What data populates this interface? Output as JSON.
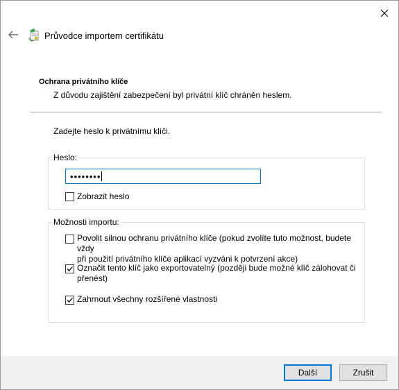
{
  "window": {
    "title": "Průvodce importem certifikátu"
  },
  "icons": {
    "close": "close-icon",
    "back": "back-arrow-icon",
    "wizard": "certificate-wizard-icon"
  },
  "header": {
    "heading": "Ochrana privátního klíče",
    "description": "Z důvodu zajištění zabezpečení byl privátní klíč chráněn heslem."
  },
  "main": {
    "prompt": "Zadejte heslo k privátnímu klíči.",
    "password_group": {
      "legend": "Heslo:",
      "value": "••••••••",
      "show_password": {
        "label": "Zobrazit heslo",
        "checked": false
      }
    },
    "import_options": {
      "legend": "Možnosti importu:",
      "options": [
        {
          "label_line1": "Povolit silnou ochranu privátního klíče (pokud zvolíte tuto možnost, budete vždy",
          "label_line2": "při použití privátního klíče aplikací vyzváni k potvrzení akce)",
          "checked": false
        },
        {
          "label_line1": "Označit tento klíč jako exportovatelný (později bude možné klíč zálohovat či",
          "label_line2": "přenést)",
          "checked": true
        },
        {
          "label_line1": "Zahrnout všechny rozšířené vlastnosti",
          "label_line2": "",
          "checked": true
        }
      ]
    }
  },
  "footer": {
    "next_label": "Další",
    "cancel_label": "Zrušit"
  },
  "colors": {
    "accent": "#0078d7",
    "footer_bg": "#f0f0f0"
  }
}
